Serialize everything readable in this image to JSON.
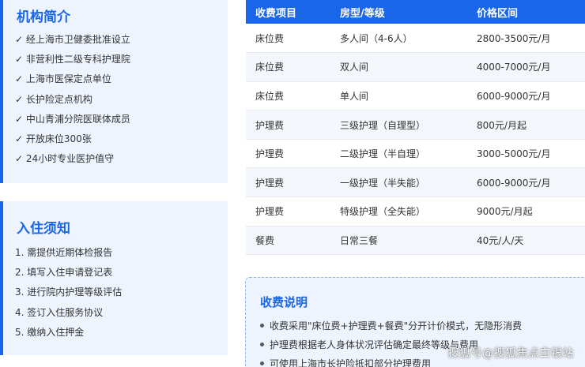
{
  "intro": {
    "title": "机构简介",
    "items": [
      "✓ 经上海市卫健委批准设立",
      "✓ 非营利性二级专科护理院",
      "✓ 上海市医保定点单位",
      "✓ 长护险定点机构",
      "✓ 中山青浦分院医联体成员",
      "✓ 开放床位300张",
      "✓ 24小时专业医护值守"
    ]
  },
  "checkin": {
    "title": "入住须知",
    "items": [
      "1. 需提供近期体检报告",
      "2. 填写入住申请登记表",
      "3. 进行院内护理等级评估",
      "4. 签订入住服务协议",
      "5. 缴纳入住押金"
    ]
  },
  "price_table": {
    "headers": [
      "收费项目",
      "房型/等级",
      "价格区间"
    ],
    "rows": [
      [
        "床位费",
        "多人间（4-6人）",
        "2800-3500元/月"
      ],
      [
        "床位费",
        "双人间",
        "4000-7000元/月"
      ],
      [
        "床位费",
        "单人间",
        "6000-9000元/月"
      ],
      [
        "护理费",
        "三级护理（自理型）",
        "800元/月起"
      ],
      [
        "护理费",
        "二级护理（半自理）",
        "3000-5000元/月"
      ],
      [
        "护理费",
        "一级护理（半失能）",
        "6000-9000元/月"
      ],
      [
        "护理费",
        "特级护理（全失能）",
        "9000元/月起"
      ],
      [
        "餐费",
        "日常三餐",
        "40元/人/天"
      ]
    ]
  },
  "fee_notes": {
    "title": "收费说明",
    "items": [
      "收费采用\"床位费+护理费+餐费\"分开计价模式，无隐形消费",
      "护理费根据老人身体状况评估确定最终等级与费用",
      "可使用上海市长护险抵扣部分护理费用"
    ]
  },
  "watermark": "搜狐号@搜狐焦点白银站",
  "colors": {
    "accent": "#1a66e8",
    "card_bg": "#eef4fe",
    "row_alt": "#f3f6fb"
  }
}
